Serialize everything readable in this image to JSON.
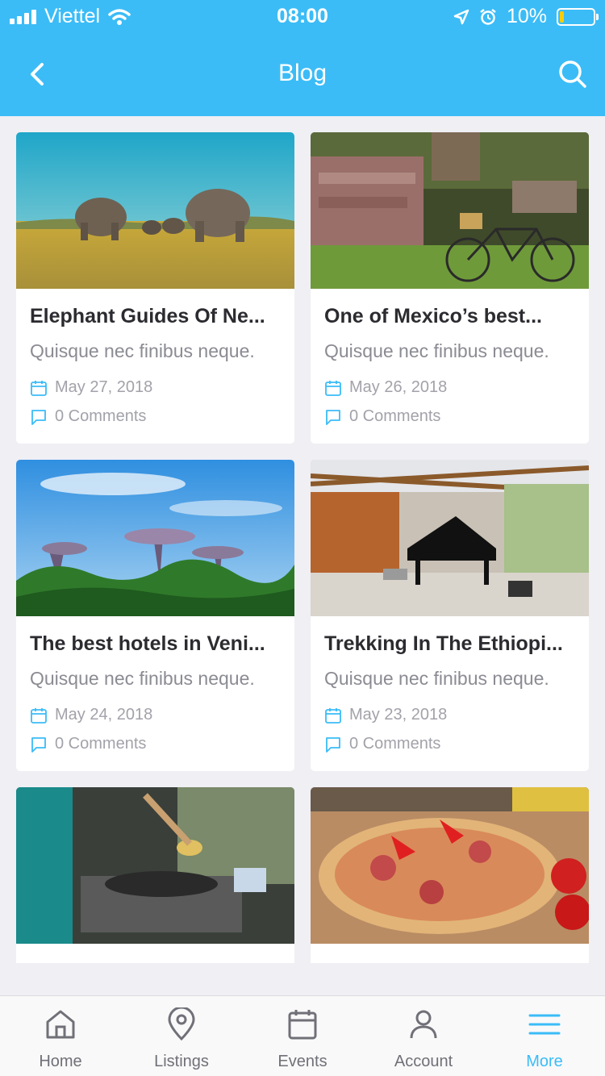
{
  "status_bar": {
    "carrier": "Viettel",
    "time": "08:00",
    "battery": "10%"
  },
  "header": {
    "title": "Blog"
  },
  "posts": [
    {
      "title": "Elephant Guides Of Ne...",
      "excerpt": "Quisque nec finibus neque.",
      "date": "May 27, 2018",
      "comments": "0 Comments",
      "image": "elephants-savanna"
    },
    {
      "title": "One of Mexico’s best...",
      "excerpt": "Quisque nec finibus neque.",
      "date": "May 26, 2018",
      "comments": "0 Comments",
      "image": "ruins-bicycle"
    },
    {
      "title": "The best hotels in Veni...",
      "excerpt": "Quisque nec finibus neque.",
      "date": "May 24, 2018",
      "comments": "0 Comments",
      "image": "supertree-garden"
    },
    {
      "title": "Trekking In The Ethiopi...",
      "excerpt": "Quisque nec finibus neque.",
      "date": "May 23, 2018",
      "comments": "0 Comments",
      "image": "piano-lounge"
    },
    {
      "title": "",
      "excerpt": "",
      "date": "",
      "comments": "",
      "image": "street-cooking"
    },
    {
      "title": "",
      "excerpt": "",
      "date": "",
      "comments": "",
      "image": "pizza"
    }
  ],
  "tabbar": {
    "items": [
      {
        "label": "Home",
        "icon": "home-icon"
      },
      {
        "label": "Listings",
        "icon": "location-pin-icon"
      },
      {
        "label": "Events",
        "icon": "calendar-icon"
      },
      {
        "label": "Account",
        "icon": "user-icon"
      },
      {
        "label": "More",
        "icon": "menu-icon"
      }
    ],
    "active": "More"
  },
  "colors": {
    "accent": "#3bbcf7",
    "background": "#efeff4",
    "title_text": "#2b2b30",
    "muted_text": "#8b8b93"
  }
}
